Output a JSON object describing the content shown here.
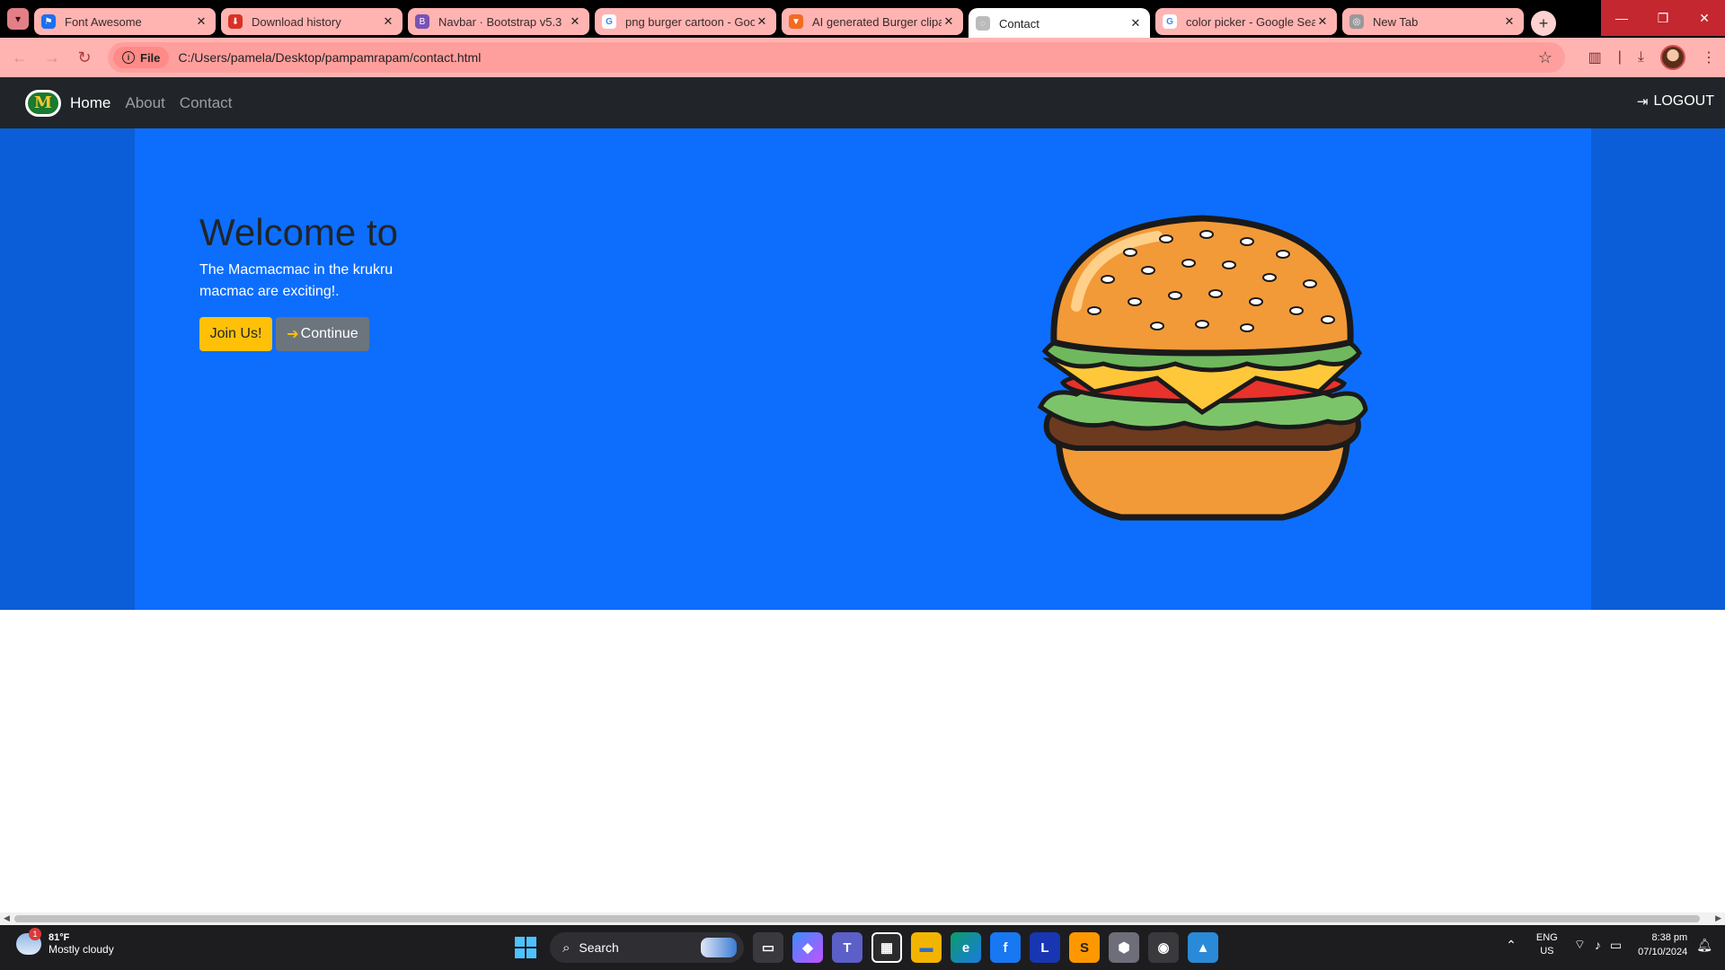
{
  "browser": {
    "tabs": [
      {
        "title": "Font Awesome",
        "favicon": "font-awesome-icon",
        "color": "#1c6ff0"
      },
      {
        "title": "Download history",
        "favicon": "download-icon",
        "color": "#d93025"
      },
      {
        "title": "Navbar · Bootstrap v5.3",
        "favicon": "bootstrap-icon",
        "color": "#7952b3"
      },
      {
        "title": "png burger cartoon - Goo",
        "favicon": "google-icon",
        "color": "#4285f4"
      },
      {
        "title": "AI generated Burger clipa",
        "favicon": "brave-icon",
        "color": "#f26b21"
      },
      {
        "title": "Contact",
        "favicon": "globe-icon",
        "color": "#888888",
        "active": true
      },
      {
        "title": "color picker - Google Sea",
        "favicon": "google-icon",
        "color": "#4285f4"
      },
      {
        "title": "New Tab",
        "favicon": "chrome-icon",
        "color": "#888888"
      }
    ],
    "close_glyph": "✕",
    "new_tab_glyph": "+",
    "window": {
      "minimize": "—",
      "restore": "❐",
      "close": "✕"
    },
    "address": {
      "chip_label": "File",
      "url": "C:/Users/pamela/Desktop/pampamrapam/contact.html"
    }
  },
  "site": {
    "brand_letter": "M",
    "nav": [
      {
        "label": "Home",
        "active": true
      },
      {
        "label": "About"
      },
      {
        "label": "Contact"
      }
    ],
    "logout_label": "LOGOUT",
    "hero": {
      "title": "Welcome to",
      "text": "The Macmacmac in the krukru macmac are exciting!.",
      "join_label": "Join Us!",
      "continue_label": "Continue",
      "continue_arrow": "➔"
    },
    "colors": {
      "navbar": "#212529",
      "hero": "#0d6efd",
      "join": "#ffc107",
      "continue": "#6c757d"
    }
  },
  "taskbar": {
    "weather_temp": "81°F",
    "weather_desc": "Mostly cloudy",
    "weather_badge": "1",
    "search_label": "Search",
    "apps": [
      "task-view-icon",
      "copilot-icon",
      "teams-icon",
      "store-icon",
      "file-explorer-icon",
      "edge-icon",
      "facebook-icon",
      "l-app-icon",
      "sublime-text-icon",
      "shield-app-icon",
      "chrome-icon",
      "photos-icon"
    ],
    "l_app_letter": "L",
    "facebook_letter": "f",
    "lang_line1": "ENG",
    "lang_line2": "US",
    "time": "8:38 pm",
    "date": "07/10/2024"
  }
}
